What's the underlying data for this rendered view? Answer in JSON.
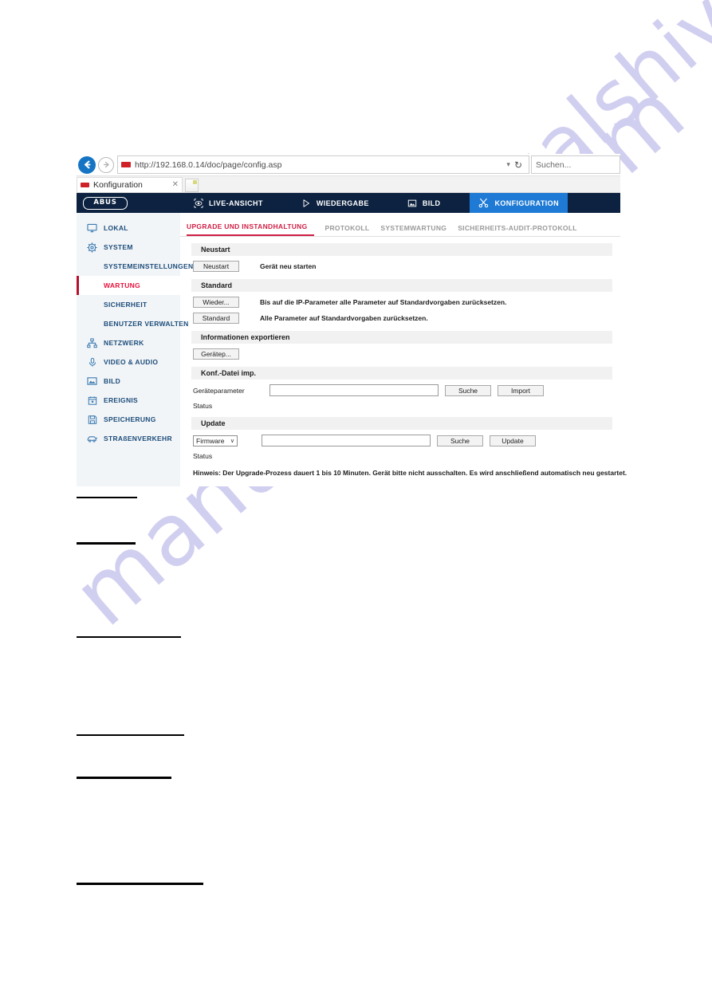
{
  "browser": {
    "url": "http://192.168.0.14/doc/page/config.asp",
    "search_placeholder": "Suchen...",
    "tab_title": "Konfiguration",
    "back_icon": "back-arrow-icon",
    "forward_icon": "forward-arrow-icon",
    "reload_icon": "reload-icon",
    "caret": "▾",
    "reload_glyph": "↻",
    "close_glyph": "✕"
  },
  "appnav": {
    "logo": "ABUS",
    "items": [
      {
        "label": "LIVE-ANSICHT",
        "icon": "eye-icon",
        "active": false
      },
      {
        "label": "WIEDERGABE",
        "icon": "play-icon",
        "active": false
      },
      {
        "label": "BILD",
        "icon": "picture-icon",
        "active": false
      },
      {
        "label": "KONFIGURATION",
        "icon": "tools-icon",
        "active": true
      }
    ]
  },
  "sidebar": {
    "items": [
      {
        "label": "LOKAL",
        "icon": "monitor-icon",
        "type": "top"
      },
      {
        "label": "SYSTEM",
        "icon": "gear-icon",
        "type": "top"
      },
      {
        "label": "SYSTEMEINSTELLUNGEN",
        "icon": "",
        "type": "sub"
      },
      {
        "label": "WARTUNG",
        "icon": "",
        "type": "sub",
        "active": true
      },
      {
        "label": "SICHERHEIT",
        "icon": "",
        "type": "sub"
      },
      {
        "label": "BENUTZER VERWALTEN",
        "icon": "",
        "type": "sub"
      },
      {
        "label": "NETZWERK",
        "icon": "network-icon",
        "type": "top"
      },
      {
        "label": "VIDEO & AUDIO",
        "icon": "microphone-icon",
        "type": "top"
      },
      {
        "label": "BILD",
        "icon": "picture-icon",
        "type": "top"
      },
      {
        "label": "EREIGNIS",
        "icon": "calendar-icon",
        "type": "top"
      },
      {
        "label": "SPEICHERUNG",
        "icon": "floppy-disk-icon",
        "type": "top"
      },
      {
        "label": "STRAßENVERKEHR",
        "icon": "car-icon",
        "type": "top"
      }
    ]
  },
  "content": {
    "tabs": [
      {
        "label": "UPGRADE UND INSTANDHALTUNG",
        "active": true
      },
      {
        "label": "PROTOKOLL",
        "active": false
      },
      {
        "label": "SYSTEMWARTUNG",
        "active": false
      },
      {
        "label": "SICHERHEITS-AUDIT-PROTOKOLL",
        "active": false
      }
    ],
    "sections": {
      "neustart": {
        "heading": "Neustart",
        "button": "Neustart",
        "description": "Gerät neu starten"
      },
      "standard": {
        "heading": "Standard",
        "button_wieder": "Wieder...",
        "desc_wieder": "Bis auf die IP-Parameter alle Parameter auf Standardvorgaben zurücksetzen.",
        "button_standard": "Standard",
        "desc_standard": "Alle Parameter auf Standardvorgaben zurücksetzen."
      },
      "export": {
        "heading": "Informationen exportieren",
        "button": "Gerätep..."
      },
      "import": {
        "heading": "Konf.-Datei imp.",
        "field_label": "Geräteparameter",
        "field_value": "",
        "button_browse": "Suche",
        "button_action": "Import",
        "status_label": "Status"
      },
      "update": {
        "heading": "Update",
        "select_value": "Firmware",
        "select_arrow": "∨",
        "field_value": "",
        "button_browse": "Suche",
        "button_action": "Update",
        "status_label": "Status",
        "note": "Hinweis: Der Upgrade-Prozess dauert 1 bis 10 Minuten. Gerät bitte nicht ausschalten. Es wird anschließend automatisch neu gestartet."
      }
    }
  },
  "watermark": {
    "text": "manualshive.com",
    "color": "#cfcdf0"
  },
  "colors": {
    "nav_background": "#0d2240",
    "nav_active": "#1e7ad4",
    "sidebar_background": "#f2f5f8",
    "sidebar_text": "#1d4d7a",
    "active_red": "#e8123c",
    "tab_active_red": "#cf1f45",
    "section_header": "#f1f1f1"
  }
}
